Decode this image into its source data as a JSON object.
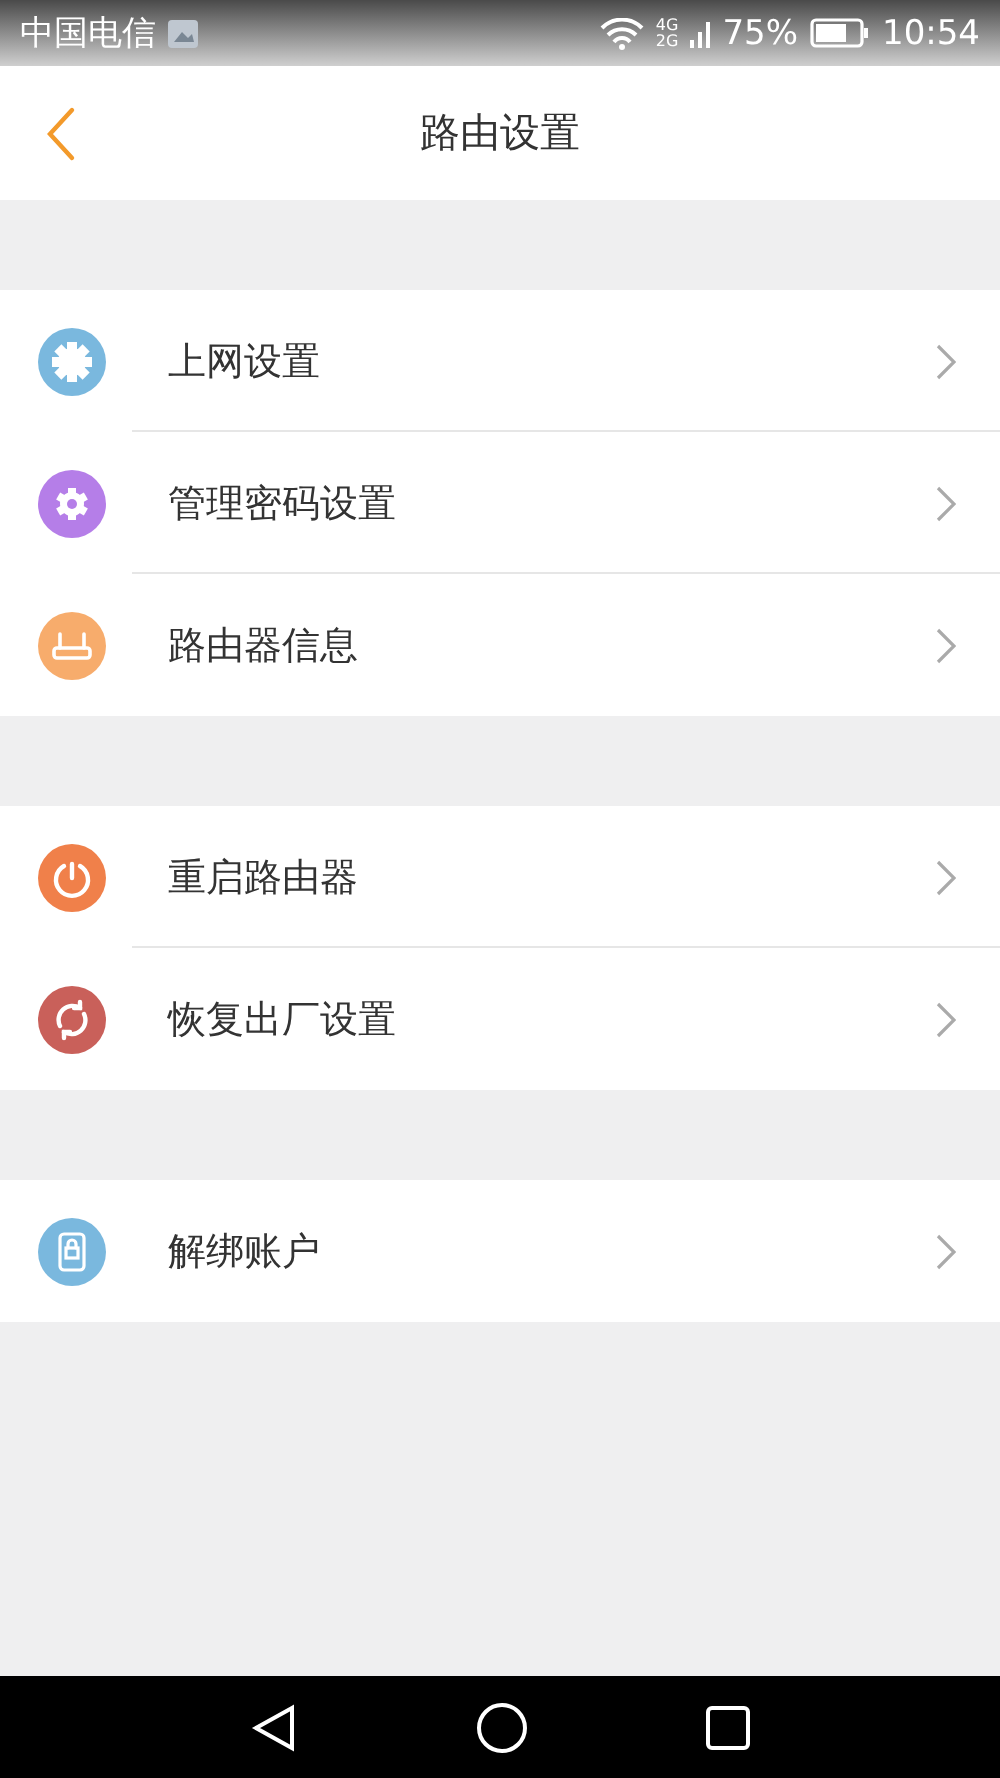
{
  "status_bar": {
    "carrier": "中国电信",
    "network_top": "4G",
    "network_bottom": "2G",
    "battery": "75%",
    "time": "10:54"
  },
  "header": {
    "title": "路由设置"
  },
  "groups": [
    {
      "items": [
        {
          "label": "上网设置",
          "kind": "gear",
          "color": "#7ab8de"
        },
        {
          "label": "管理密码设置",
          "kind": "cog",
          "color": "#b57ee8"
        },
        {
          "label": "路由器信息",
          "kind": "router",
          "color": "#f7ac6c"
        }
      ]
    },
    {
      "items": [
        {
          "label": "重启路由器",
          "kind": "power",
          "color": "#f0804a"
        },
        {
          "label": "恢复出厂设置",
          "kind": "refresh",
          "color": "#c9605a"
        }
      ]
    },
    {
      "items": [
        {
          "label": "解绑账户",
          "kind": "lock",
          "color": "#7ab8de"
        }
      ]
    }
  ]
}
